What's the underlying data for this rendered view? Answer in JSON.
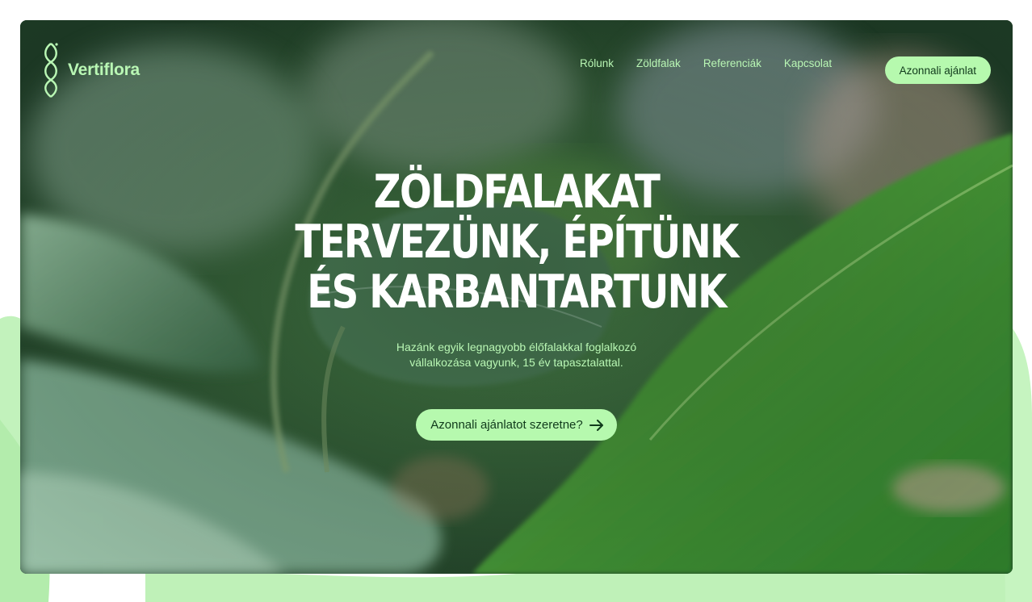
{
  "brand": {
    "name": "Vertiflora",
    "logo_icon": "braided-leaf-icon",
    "accent_color": "#b6f9ae"
  },
  "nav": {
    "items": [
      {
        "label": "Rólunk"
      },
      {
        "label": "Zöldfalak"
      },
      {
        "label": "Referenciák"
      },
      {
        "label": "Kapcsolat"
      }
    ],
    "cta_label": "Azonnali ajánlat"
  },
  "hero": {
    "headline_lines": [
      "Zöldfalakat",
      "tervezünk, építünk",
      "és karbantartunk"
    ],
    "subtitle_lines": [
      "Hazánk egyik legnagyobb élőfalakkal foglalkozó",
      "vállalkozása vagyunk, 15 év tapasztalattal."
    ],
    "cta_label": "Azonnali ajánlatot szeretne?",
    "cta_icon": "arrow-right-icon"
  },
  "colors": {
    "text_primary": "#ffffff",
    "text_accent": "#b9f7b4",
    "button_text": "#103a1b"
  }
}
